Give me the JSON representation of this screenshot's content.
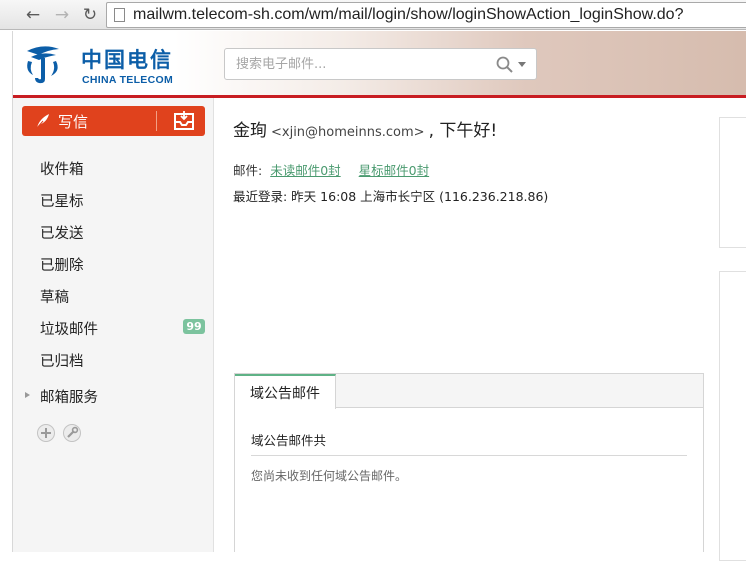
{
  "browser": {
    "url": "mailwm.telecom-sh.com/wm/mail/login/show/loginShowAction_loginShow.do?",
    "back_icon": "arrow-left-icon",
    "forward_icon": "arrow-right-icon",
    "reload_icon": "reload-icon"
  },
  "header": {
    "logo_cn": "中国电信",
    "logo_en": "CHINA TELECOM",
    "search_placeholder": "搜索电子邮件...",
    "brand_color": "#0c5ea8",
    "accent_line_color": "#c81d22"
  },
  "sidebar": {
    "compose_label": "写信",
    "folders": [
      {
        "label": "收件箱"
      },
      {
        "label": "已星标"
      },
      {
        "label": "已发送"
      },
      {
        "label": "已删除"
      },
      {
        "label": "草稿"
      },
      {
        "label": "垃圾邮件",
        "badge": "99"
      },
      {
        "label": "已归档"
      }
    ],
    "services_label": "邮箱服务",
    "compose_color": "#e0421d"
  },
  "main": {
    "user_name": "金珣",
    "user_email": "<xjin@homeinns.com>",
    "greeting_suffix": ", 下午好!",
    "mail_label": "邮件:",
    "unread_link": "未读邮件0封",
    "starred_link": "星标邮件0封",
    "last_login": "最近登录: 昨天 16:08 上海市长宁区 (116.236.218.86)"
  },
  "announcement": {
    "tab_label": "域公告邮件",
    "title": "域公告邮件共",
    "empty_text": "您尚未收到任何域公告邮件。",
    "tab_accent": "#5fb286"
  }
}
